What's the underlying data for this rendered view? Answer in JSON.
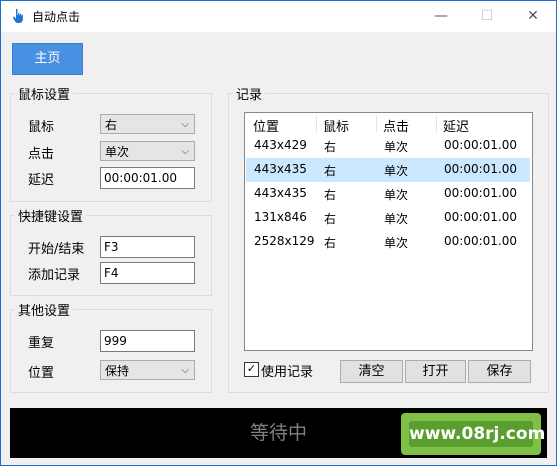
{
  "window": {
    "title": "自动点击",
    "minimize_glyph": "—",
    "maximize_glyph": "☐",
    "close_glyph": "✕"
  },
  "home_button": "主页",
  "mouse_settings": {
    "title": "鼠标设置",
    "mouse_label": "鼠标",
    "mouse_value": "右",
    "click_label": "点击",
    "click_value": "单次",
    "delay_label": "延迟",
    "delay_value": "00:00:01.00"
  },
  "hotkey_settings": {
    "title": "快捷键设置",
    "start_stop_label": "开始/结束",
    "start_stop_value": "F3",
    "add_record_label": "添加记录",
    "add_record_value": "F4"
  },
  "other_settings": {
    "title": "其他设置",
    "repeat_label": "重复",
    "repeat_value": "999",
    "position_label": "位置",
    "position_value": "保持"
  },
  "records": {
    "title": "记录",
    "columns": [
      "位置",
      "鼠标",
      "点击",
      "延迟"
    ],
    "rows": [
      [
        "443x429",
        "右",
        "单次",
        "00:00:01.00"
      ],
      [
        "443x435",
        "右",
        "单次",
        "00:00:01.00"
      ],
      [
        "443x435",
        "右",
        "单次",
        "00:00:01.00"
      ],
      [
        "131x846",
        "右",
        "单次",
        "00:00:01.00"
      ],
      [
        "2528x129",
        "右",
        "单次",
        "00:00:01.00"
      ]
    ],
    "selected_row": 1,
    "use_records_label": "使用记录",
    "use_records_checked": true,
    "check_glyph": "✓",
    "clear_button": "清空",
    "open_button": "打开",
    "save_button": "保存"
  },
  "status_text": "等待中",
  "watermark": "www.08rj.com",
  "icons": {
    "app": "hand-pointer-icon",
    "dropdown": "chevron-down-icon",
    "dropdown_glyph": "⌵"
  }
}
